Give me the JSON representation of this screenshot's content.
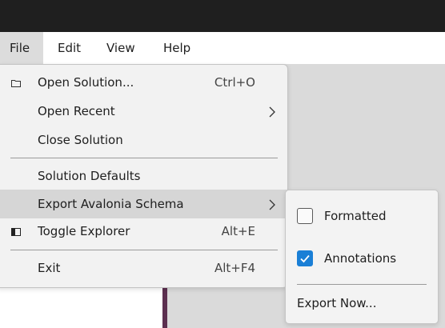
{
  "menubar": {
    "items": [
      {
        "label": "File"
      },
      {
        "label": "Edit"
      },
      {
        "label": "View"
      },
      {
        "label": "Help"
      }
    ]
  },
  "file_menu": {
    "items": [
      {
        "label": "Open Solution...",
        "shortcut": "Ctrl+O",
        "icon": "folder-icon"
      },
      {
        "label": "Open Recent",
        "submenu": true
      },
      {
        "label": "Close Solution"
      },
      {
        "label": "Solution Defaults"
      },
      {
        "label": "Export Avalonia Schema",
        "submenu": true,
        "highlighted": true
      },
      {
        "label": "Toggle Explorer",
        "shortcut": "Alt+E",
        "icon": "panel-icon"
      },
      {
        "label": "Exit",
        "shortcut": "Alt+F4"
      }
    ]
  },
  "export_submenu": {
    "formatted": {
      "label": "Formatted",
      "checked": false
    },
    "annotations": {
      "label": "Annotations",
      "checked": true
    },
    "export_now": "Export Now..."
  },
  "colors": {
    "accent": "#1a7fd6",
    "title_bar": "#1f1f1f",
    "workspace_bar": "#5c2f50"
  }
}
